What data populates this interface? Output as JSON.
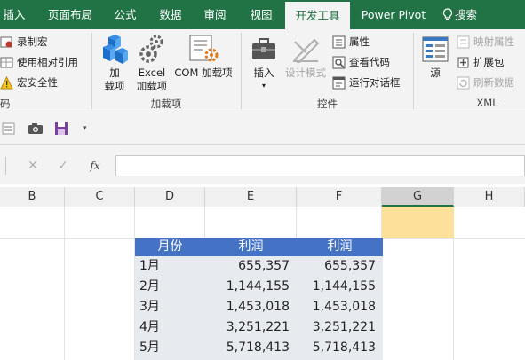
{
  "tabs": [
    {
      "label": "插入"
    },
    {
      "label": "页面布局"
    },
    {
      "label": "公式"
    },
    {
      "label": "数据"
    },
    {
      "label": "审阅"
    },
    {
      "label": "视图"
    },
    {
      "label": "开发工具",
      "active": true
    },
    {
      "label": "Power Pivot"
    },
    {
      "label": "搜索"
    }
  ],
  "ribbon": {
    "code": {
      "record_macro": "录制宏",
      "relative_ref": "使用相对引用",
      "macro_security": "宏安全性",
      "group_label": "码"
    },
    "addins": {
      "addins_l1": "加",
      "addins_l2": "载项",
      "excel_l1": "Excel",
      "excel_l2": "加载项",
      "com": "COM 加载项",
      "group_label": "加载项"
    },
    "controls": {
      "insert": "插入",
      "design_mode": "设计模式",
      "properties": "属性",
      "view_code": "查看代码",
      "run_dialog": "运行对话框",
      "group_label": "控件"
    },
    "xml": {
      "source": "源",
      "map_props": "映射属性",
      "expansion_packs": "扩展包",
      "refresh_data": "刷新数据",
      "group_label": "XML"
    }
  },
  "formula_bar": {
    "fx": "fx",
    "value": ""
  },
  "columns": [
    "B",
    "C",
    "D",
    "E",
    "F",
    "G",
    "H"
  ],
  "selected_column": "G",
  "table": {
    "headers": [
      "月份",
      "利润",
      "利润"
    ],
    "rows": [
      [
        "1月",
        "655,357",
        "655,357"
      ],
      [
        "2月",
        "1,144,155",
        "1,144,155"
      ],
      [
        "3月",
        "1,453,018",
        "1,453,018"
      ],
      [
        "4月",
        "3,251,221",
        "3,251,221"
      ],
      [
        "5月",
        "5,718,413",
        "5,718,413"
      ]
    ]
  },
  "colors": {
    "excel_green": "#217346",
    "table_header": "#4472c4",
    "table_row": "#e7ebf0",
    "selected_cell": "#fde19a"
  }
}
